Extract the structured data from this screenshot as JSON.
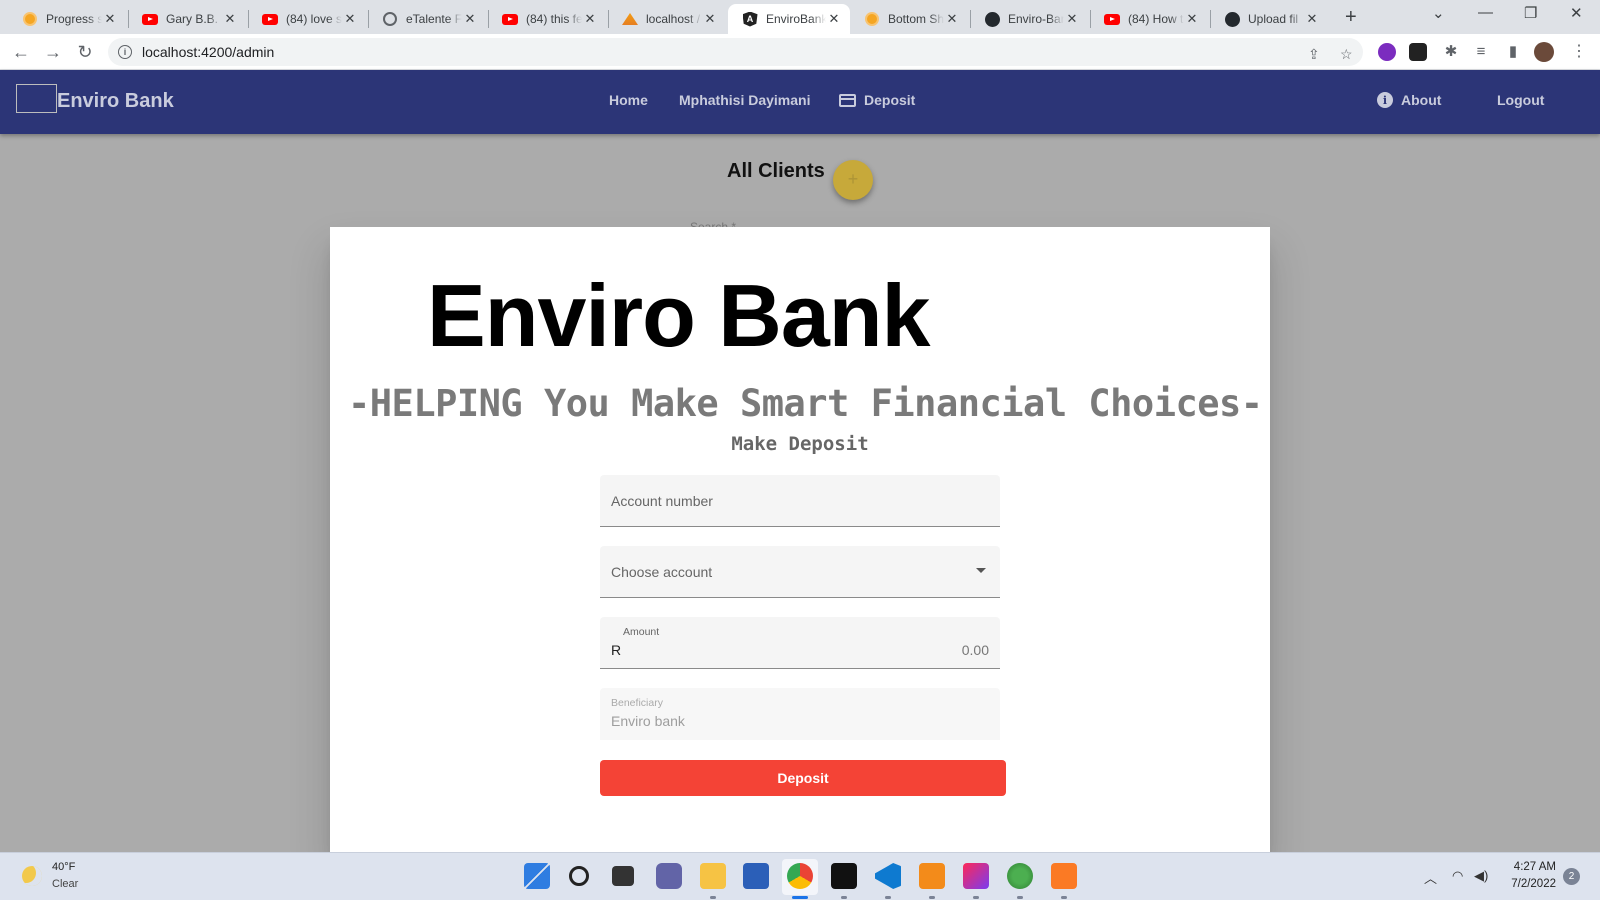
{
  "browser": {
    "tabs": [
      {
        "title": "Progress s",
        "icon": "orange-circle-icon"
      },
      {
        "title": "Gary B.B. C",
        "icon": "youtube-icon"
      },
      {
        "title": "(84) love s",
        "icon": "youtube-icon"
      },
      {
        "title": "eTalente F",
        "icon": "globe-icon"
      },
      {
        "title": "(84) this fe",
        "icon": "youtube-icon"
      },
      {
        "title": "localhost /",
        "icon": "phpmyadmin-icon"
      },
      {
        "title": "EnviroBank",
        "icon": "angular-icon",
        "active": true
      },
      {
        "title": "Bottom Sh",
        "icon": "orange-circle-icon"
      },
      {
        "title": "Enviro-Ban",
        "icon": "github-icon"
      },
      {
        "title": "(84) How t",
        "icon": "youtube-icon"
      },
      {
        "title": "Upload fil",
        "icon": "github-icon"
      }
    ],
    "url": "localhost:4200/admin"
  },
  "navbar": {
    "brand": "Enviro Bank",
    "links": {
      "home": "Home",
      "user": "Mphathisi Dayimani",
      "deposit": "Deposit",
      "about": "About",
      "logout": "Logout"
    },
    "color": "#2c3577"
  },
  "page": {
    "title": "All Clients",
    "fab_label": "+",
    "search_placeholder": "Search *"
  },
  "dialog": {
    "title": "Enviro Bank",
    "tagline": "-HELPING You Make Smart Financial Choices-",
    "subtitle": "Make Deposit",
    "account_number_placeholder": "Account number",
    "choose_account_placeholder": "Choose account",
    "amount_label": "Amount",
    "amount_prefix": "R",
    "amount_value": "0.00",
    "beneficiary_label": "Beneficiary",
    "beneficiary_value": "Enviro bank",
    "deposit_button": "Deposit",
    "button_color": "#f44336"
  },
  "taskbar": {
    "weather_temp": "40°F",
    "weather_condition": "Clear",
    "time": "4:27 AM",
    "date": "7/2/2022",
    "notification_count": "2"
  }
}
